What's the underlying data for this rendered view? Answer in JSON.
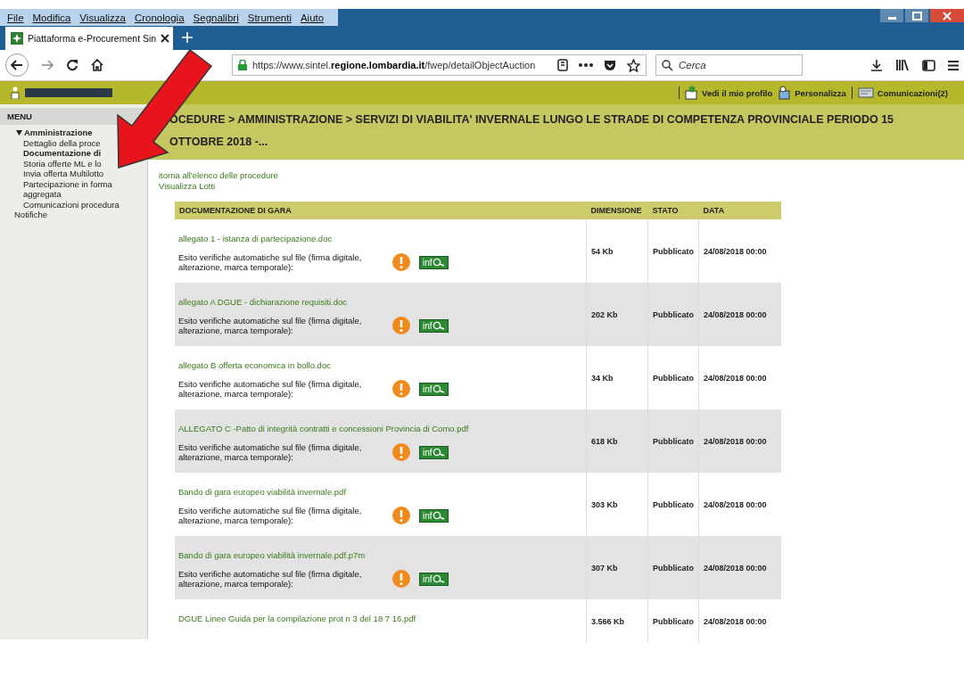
{
  "browser": {
    "menu": [
      "File",
      "Modifica",
      "Visualizza",
      "Cronologia",
      "Segnalibri",
      "Strumenti",
      "Aiuto"
    ],
    "tab": {
      "title": "Piattaforma e-Procurement Sin",
      "selected": true
    },
    "url": "https://www.sintel.**regione.lombardia.it**/fwep/detailObjectAuction",
    "search": {
      "placeholder": "Cerca"
    }
  },
  "header": {
    "links": [
      {
        "label": "Vedi il mio profilo",
        "kind": "profile"
      },
      {
        "label": "Personalizza",
        "kind": "customize"
      },
      {
        "label": "Comunicazioni(2)",
        "kind": "messages"
      }
    ]
  },
  "sidebar": {
    "title": "MENU",
    "items": [
      {
        "label": "Amministrazione",
        "expanded": true,
        "children": [
          {
            "label": "Dettaglio della proce",
            "selected": false
          },
          {
            "label": "Documentazione di",
            "selected": true
          },
          {
            "label": "Storia offerte ML e lo",
            "selected": false
          },
          {
            "label": "Invia offerta Multilotto",
            "selected": false
          },
          {
            "label": "Partecipazione in forma aggregata",
            "selected": false
          },
          {
            "label": "Comunicazioni procedura",
            "selected": false
          }
        ]
      },
      {
        "label": "Notifiche"
      }
    ]
  },
  "breadcrumb": "OCEDURE  > AMMINISTRAZIONE  > SERVIZI DI VIABILITA' INVERNALE LUNGO LE STRADE DI COMPETENZA PROVINCIALE PERIODO 15 OTTOBRE 2018 -...",
  "links": [
    "itorna all'elenco delle procedure",
    "Visualizza Lotti"
  ],
  "table": {
    "columns": [
      "DOCUMENTAZIONE DI GARA",
      "DIMENSIONE",
      "STATO",
      "DATA"
    ],
    "rows": [
      {
        "file": "allegato 1 - istanza di partecipazione.doc",
        "checks_label": "Esito verifiche automatiche sul file (firma digitale, alterazione, marca temporale):",
        "info": "inf",
        "size": "54 Kb",
        "state": "Pubblicato",
        "date": "24/08/2018 00:00"
      },
      {
        "file": "allegato A DGUE - dichiarazione requisiti.doc",
        "checks_label": "Esito verifiche automatiche sul file (firma digitale, alterazione, marca temporale):",
        "info": "inf",
        "size": "202 Kb",
        "state": "Pubblicato",
        "date": "24/08/2018 00:00"
      },
      {
        "file": "allegato B offerta economica in bollo.doc",
        "checks_label": "Esito verifiche automatiche sul file (firma digitale, alterazione, marca temporale):",
        "info": "inf",
        "size": "34 Kb",
        "state": "Pubblicato",
        "date": "24/08/2018 00:00"
      },
      {
        "file": "ALLEGATO C -Patto di integrità contratti e concessioni Provincia di Como.pdf",
        "checks_label": "Esito verifiche automatiche sul file (firma digitale, alterazione, marca temporale):",
        "info": "inf",
        "size": "618 Kb",
        "state": "Pubblicato",
        "date": "24/08/2018 00:00"
      },
      {
        "file": "Bando di gara europeo viabilità invernale.pdf",
        "checks_label": "Esito verifiche automatiche sul file (firma digitale, alterazione, marca temporale):",
        "info": "inf",
        "size": "303 Kb",
        "state": "Pubblicato",
        "date": "24/08/2018 00:00"
      },
      {
        "file": "Bando di gara europeo viabilità invernale.pdf.p7m",
        "checks_label": "Esito verifiche automatiche sul file (firma digitale, alterazione, marca temporale):",
        "info": "inf",
        "size": "307 Kb",
        "state": "Pubblicato",
        "date": "24/08/2018 00:00"
      },
      {
        "file": "DGUE Linee Guida per la compilazione prot n 3 del 18 7 16.pdf",
        "size": "3.566 Kb",
        "state": "Pubblicato",
        "date": "24/08/2018 00:00"
      }
    ]
  }
}
